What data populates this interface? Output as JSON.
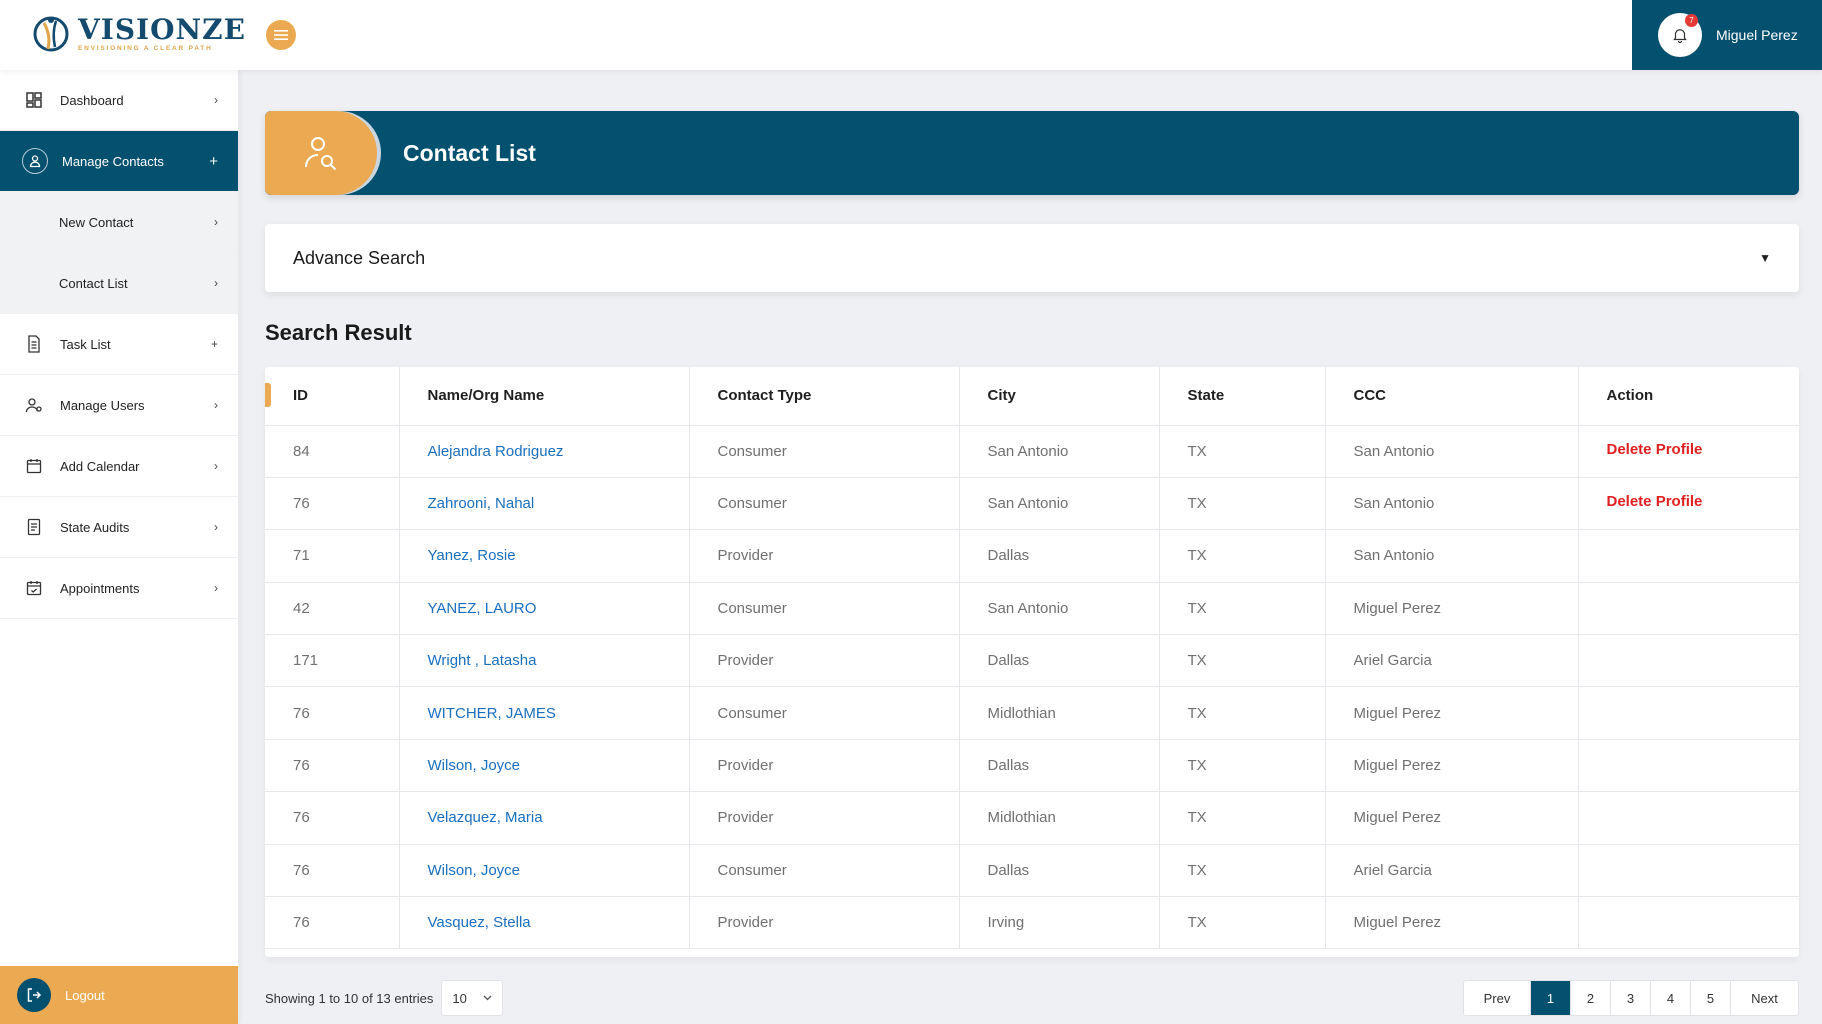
{
  "brand": {
    "name": "VISIONZE",
    "tagline": "ENVISIONING A CLEAR PATH"
  },
  "topbar": {
    "user_name": "Miguel Perez",
    "notification_count": "7"
  },
  "sidebar": {
    "items": [
      {
        "label": "Dashboard",
        "icon": "dashboard-icon",
        "indicator": "›"
      },
      {
        "label": "Manage Contacts",
        "icon": "contacts-icon",
        "indicator": "+"
      },
      {
        "label": "New Contact",
        "indicator": "›"
      },
      {
        "label": "Contact List",
        "indicator": "›"
      },
      {
        "label": "Task List",
        "icon": "document-icon",
        "indicator": "+"
      },
      {
        "label": "Manage Users",
        "icon": "users-icon",
        "indicator": "›"
      },
      {
        "label": "Add Calendar",
        "icon": "calendar-icon",
        "indicator": "›"
      },
      {
        "label": "State Audits",
        "icon": "audit-icon",
        "indicator": "›"
      },
      {
        "label": "Appointments",
        "icon": "appointment-icon",
        "indicator": "›"
      }
    ],
    "logout_label": "Logout"
  },
  "page": {
    "title": "Contact List",
    "advance_search": "Advance Search",
    "result_title": "Search Result"
  },
  "table": {
    "columns": [
      "ID",
      "Name/Org Name",
      "Contact Type",
      "City",
      "State",
      "CCC",
      "Action"
    ],
    "rows": [
      {
        "id": "84",
        "name": "Alejandra Rodriguez",
        "type": "Consumer",
        "city": "San Antonio",
        "state": "TX",
        "ccc": "San Antonio",
        "action": "Delete Profile"
      },
      {
        "id": "76",
        "name": "Zahrooni, Nahal",
        "type": "Consumer",
        "city": "San Antonio",
        "state": "TX",
        "ccc": "San Antonio",
        "action": "Delete Profile"
      },
      {
        "id": "71",
        "name": "Yanez, Rosie",
        "type": "Provider",
        "city": "Dallas",
        "state": "TX",
        "ccc": "San Antonio",
        "action": ""
      },
      {
        "id": "42",
        "name": "YANEZ, LAURO",
        "type": "Consumer",
        "city": "San Antonio",
        "state": "TX",
        "ccc": "Miguel Perez",
        "action": ""
      },
      {
        "id": "171",
        "name": "Wright , Latasha",
        "type": "Provider",
        "city": "Dallas",
        "state": "TX",
        "ccc": "Ariel Garcia",
        "action": ""
      },
      {
        "id": "76",
        "name": "WITCHER, JAMES",
        "type": "Consumer",
        "city": "Midlothian",
        "state": "TX",
        "ccc": "Miguel Perez",
        "action": ""
      },
      {
        "id": "76",
        "name": "Wilson, Joyce",
        "type": "Provider",
        "city": "Dallas",
        "state": "TX",
        "ccc": "Miguel Perez",
        "action": ""
      },
      {
        "id": "76",
        "name": "Velazquez, Maria",
        "type": "Provider",
        "city": "Midlothian",
        "state": "TX",
        "ccc": "Miguel Perez",
        "action": ""
      },
      {
        "id": "76",
        "name": "Wilson, Joyce",
        "type": "Consumer",
        "city": "Dallas",
        "state": "TX",
        "ccc": "Ariel Garcia",
        "action": ""
      },
      {
        "id": "76",
        "name": "Vasquez, Stella",
        "type": "Provider",
        "city": "Irving",
        "state": "TX",
        "ccc": "Miguel Perez",
        "action": ""
      }
    ]
  },
  "footer": {
    "entries_text": "Showing 1 to 10 of 13 entries",
    "page_size": "10",
    "prev": "Prev",
    "next": "Next",
    "pages": [
      "1",
      "2",
      "3",
      "4",
      "5"
    ],
    "active_page": "1"
  },
  "colors": {
    "primary": "#03506f",
    "accent": "#ebaa52",
    "link": "#1a6fbf",
    "danger": "#e02020"
  }
}
